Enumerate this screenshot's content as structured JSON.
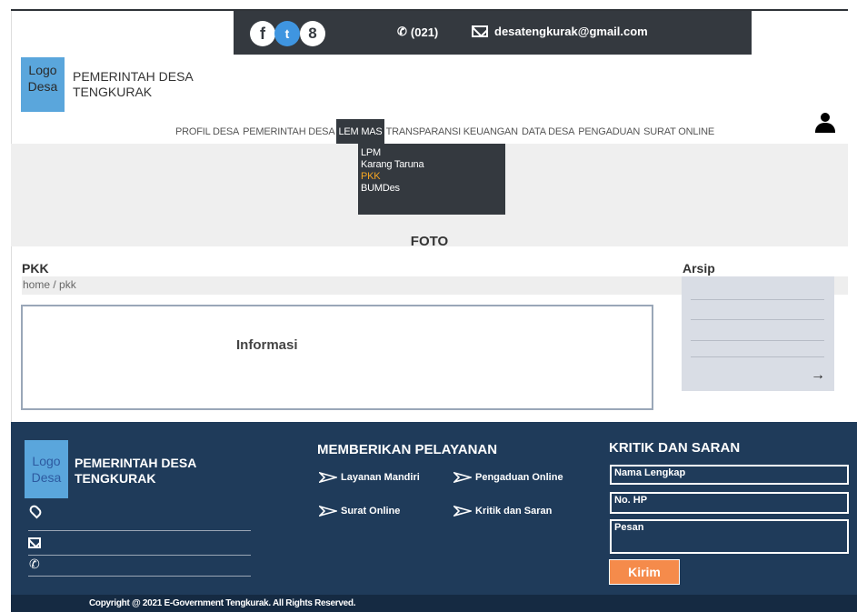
{
  "topbar": {
    "social": [
      {
        "icon": "facebook-icon",
        "glyph": "f"
      },
      {
        "icon": "twitter-icon",
        "glyph": "t"
      },
      {
        "icon": "google-plus-icon",
        "glyph": "8"
      }
    ],
    "phone": "(021)",
    "email": "desatengkurak@gmail.com"
  },
  "header": {
    "logo": [
      "Logo",
      "Desa"
    ],
    "brand": [
      "PEMERINTAH DESA",
      "TENGKURAK"
    ]
  },
  "nav": {
    "items": [
      "PROFIL DESA",
      "PEMERINTAH DESA",
      "LEM MAS",
      "TRANSPARANSI KEUANGAN",
      "DATA DESA",
      "PENGADUAN",
      "SURAT ONLINE"
    ],
    "active": "LEM MAS"
  },
  "dropdown": {
    "items": [
      "LPM",
      "Karang Taruna",
      "PKK",
      "BUMDes"
    ],
    "active": "PKK"
  },
  "hero": {
    "label": "FOTO"
  },
  "main": {
    "title": "PKK",
    "breadcrumb": "home / pkk",
    "info_label": "Informasi"
  },
  "arsip": {
    "title": "Arsip",
    "arrow": "→"
  },
  "footer": {
    "logo": [
      "Logo",
      "Desa"
    ],
    "brand": [
      "PEMERINTAH DESA",
      "TENGKURAK"
    ],
    "services_title": "MEMBERIKAN PELAYANAN",
    "services": [
      "Layanan Mandiri",
      "Pengaduan Online",
      "Surat Online",
      "Kritik dan Saran"
    ],
    "kritik_title": "KRITIK DAN SARAN",
    "fields": {
      "name": "Nama Lengkap",
      "phone": "No. HP",
      "message": "Pesan"
    },
    "submit": "Kirim",
    "copyright": "Copyright @ 2021 E-Government Tengkurak. All Rights Reserved."
  },
  "colors": {
    "dark": "#34393f",
    "footer": "#1f3b5a",
    "accent": "#f58b4b",
    "logo": "#5aa6dc",
    "active_dropdown": "#f5a623"
  }
}
